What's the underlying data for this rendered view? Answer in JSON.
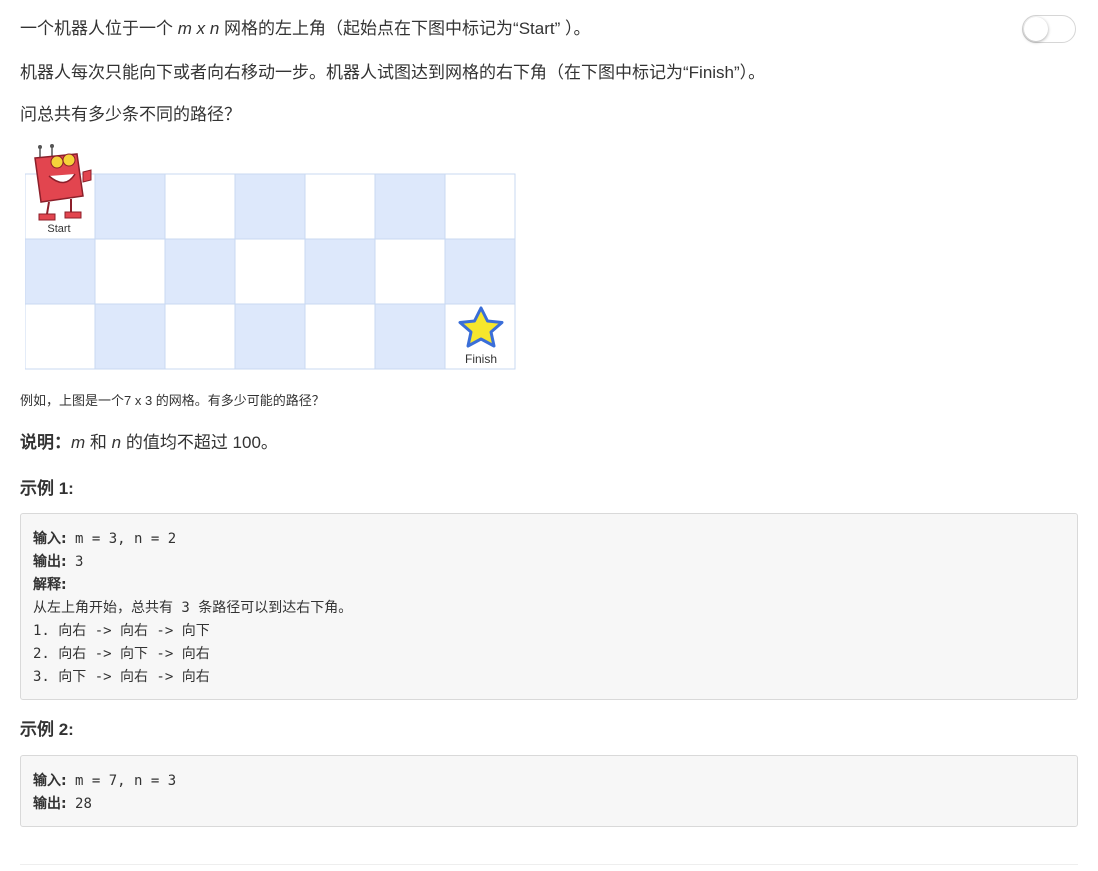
{
  "problem": {
    "p1": {
      "a": "一个机器人位于一个 ",
      "m": "m",
      "x": " x ",
      "n": "n",
      "b": " 网格的左上角（起始点在下图中标记为“Start” ）。"
    },
    "p2": "机器人每次只能向下或者向右移动一步。机器人试图达到网格的右下角（在下图中标记为“Finish”）。",
    "p3": "问总共有多少条不同的路径？",
    "figure": {
      "start_label": "Start",
      "finish_label": "Finish",
      "cols": 7,
      "rows": 3,
      "colors": {
        "blue": "#dde8fb",
        "white": "#ffffff",
        "border": "#c9d9f2",
        "star_fill": "#f6e62c",
        "star_stroke": "#3a6ed8",
        "robot": "#e2454f"
      }
    },
    "caption": "例如，上图是一个7 x 3 的网格。有多少可能的路径？",
    "note": {
      "label": "说明：",
      "m": "m",
      "and": " 和 ",
      "n": "n",
      "rest": " 的值均不超过 100。"
    }
  },
  "examples": [
    {
      "title": "示例 1:",
      "input_label": "输入:",
      "input_value": " m = 3, n = 2",
      "output_label": "输出:",
      "output_value": " 3",
      "explain_label": "解释:",
      "explain_lines": [
        "从左上角开始，总共有 3 条路径可以到达右下角。",
        "1. 向右 -> 向右 -> 向下",
        "2. 向右 -> 向下 -> 向右",
        "3. 向下 -> 向右 -> 向右"
      ]
    },
    {
      "title": "示例 2:",
      "input_label": "输入:",
      "input_value": " m = 7, n = 3",
      "output_label": "输出:",
      "output_value": " 28"
    }
  ],
  "toggle": {
    "state": "off"
  }
}
